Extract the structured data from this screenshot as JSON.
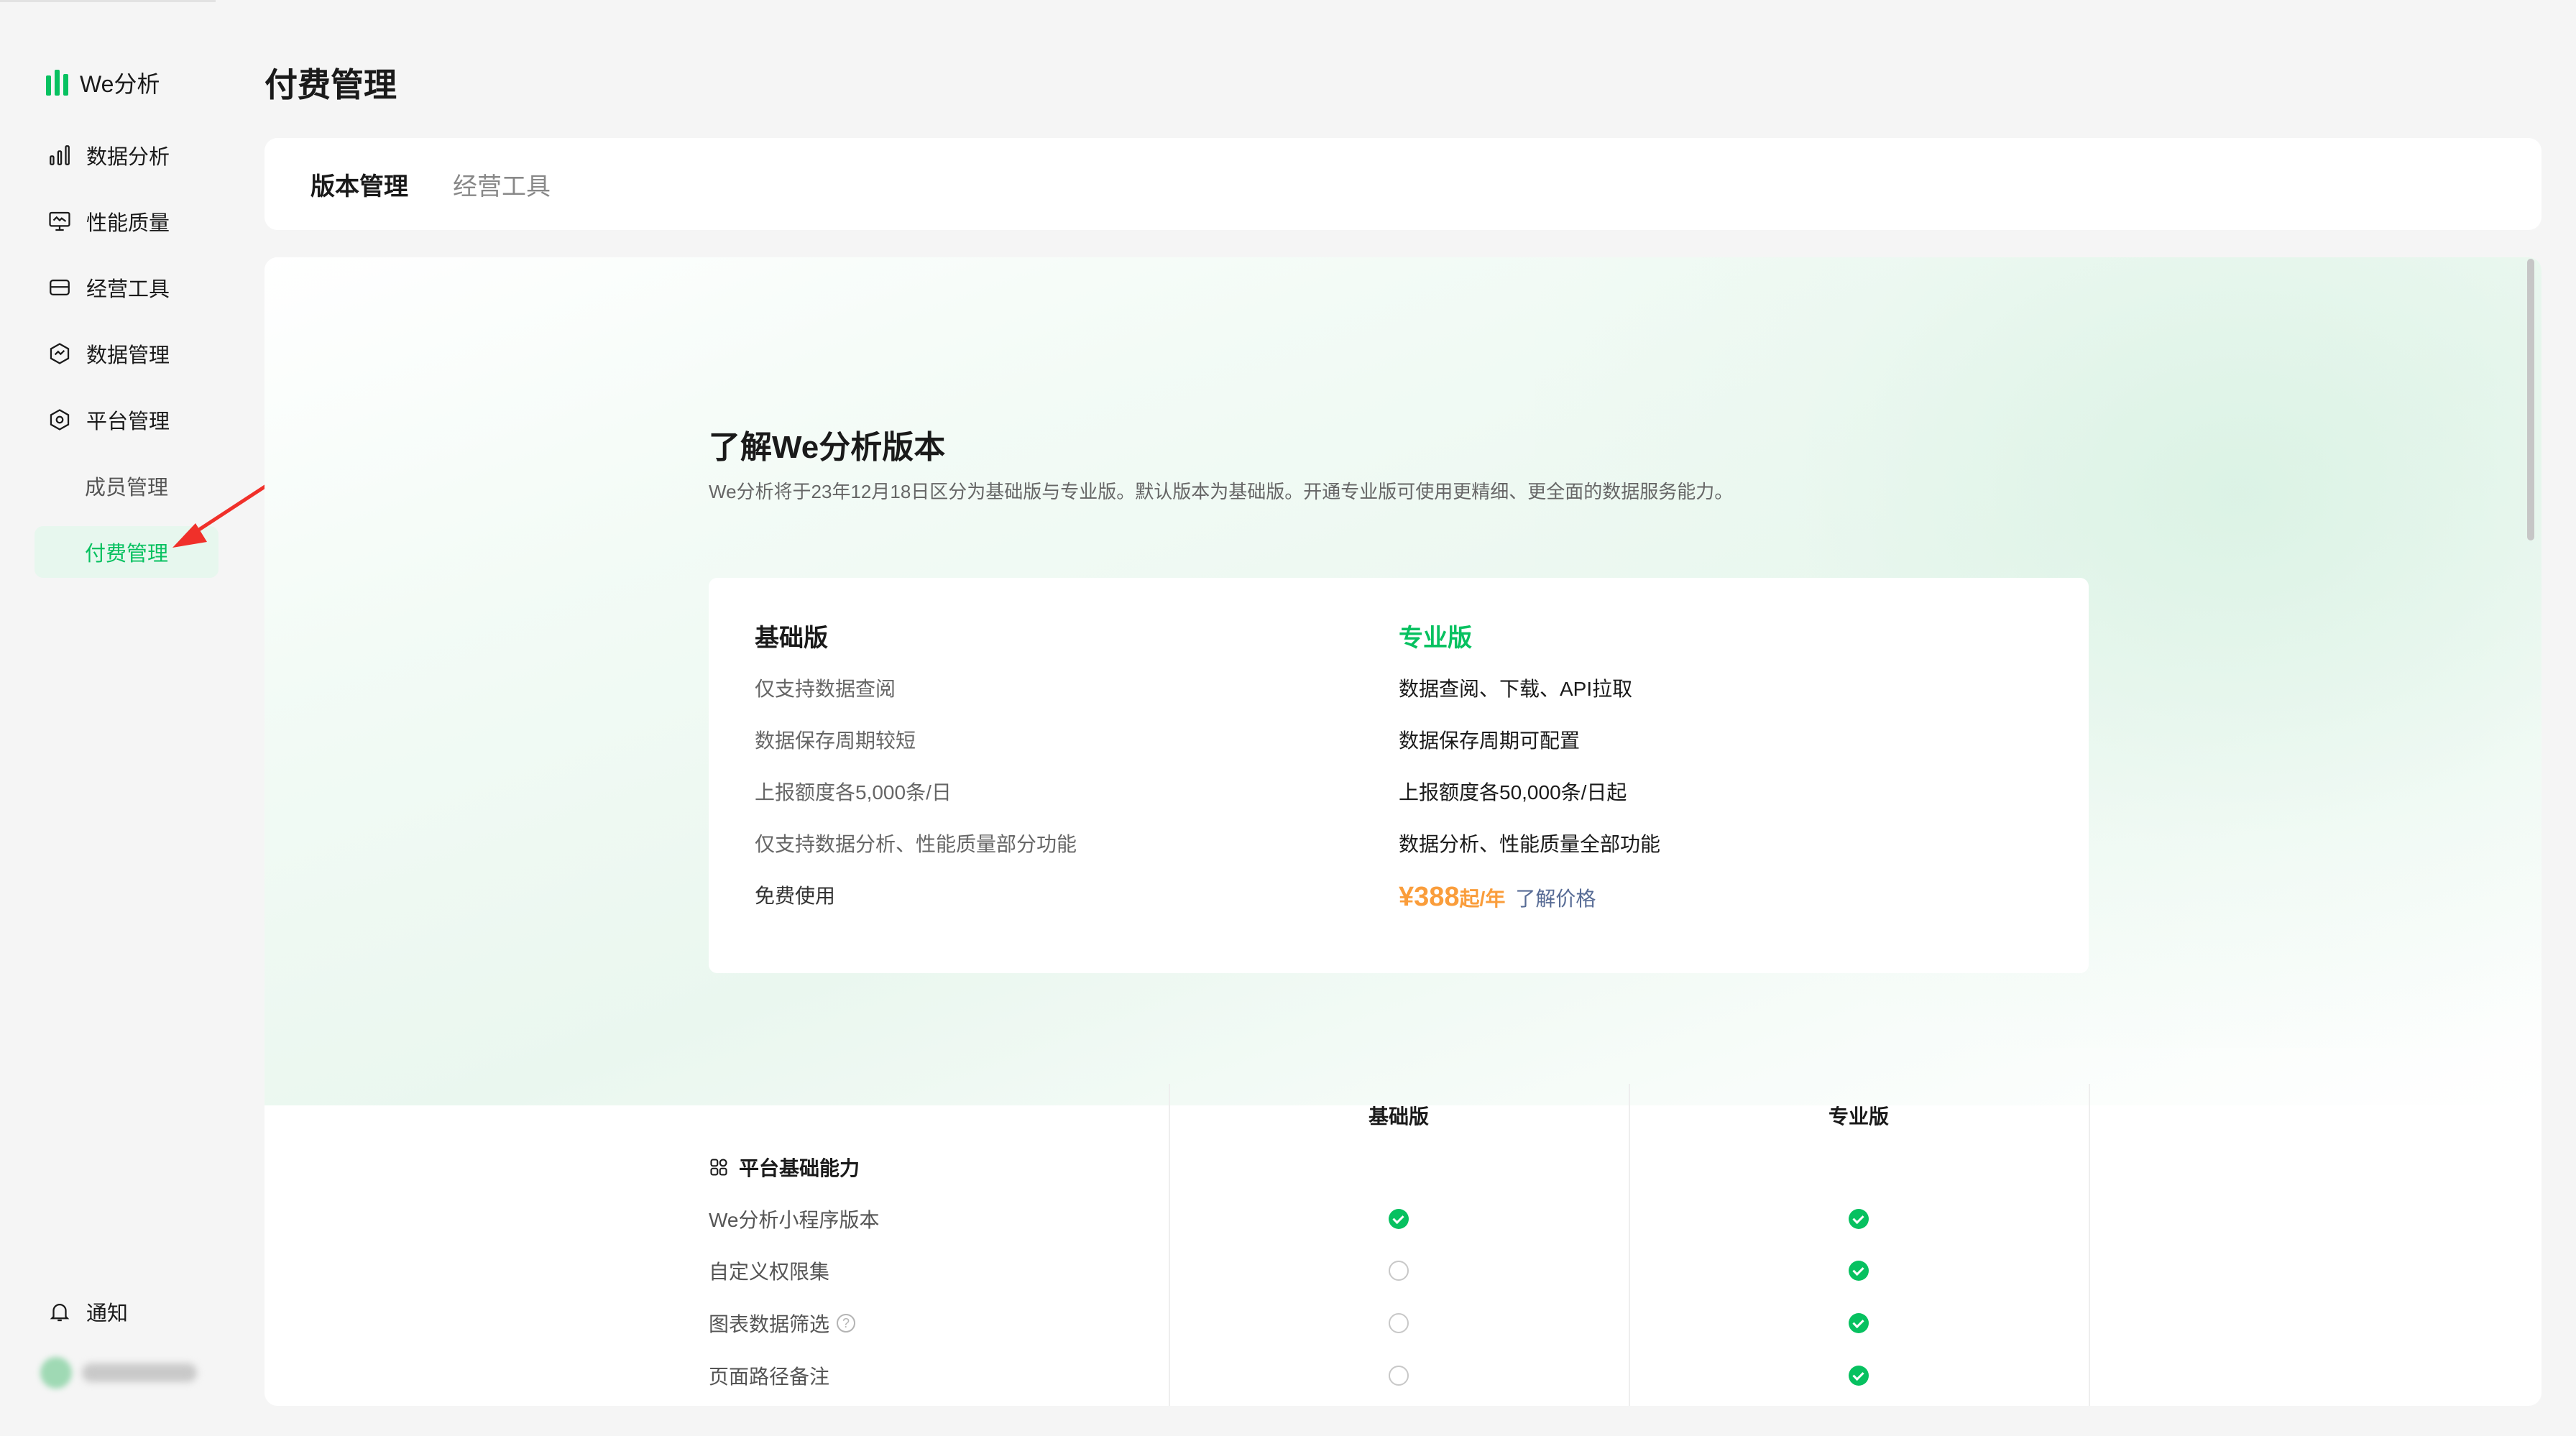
{
  "sidebar": {
    "logo_text": "We分析",
    "items": [
      {
        "label": "数据分析",
        "icon": "bar-chart-icon"
      },
      {
        "label": "性能质量",
        "icon": "monitor-icon"
      },
      {
        "label": "经营工具",
        "icon": "card-icon"
      },
      {
        "label": "数据管理",
        "icon": "hexagon-chart-icon"
      },
      {
        "label": "平台管理",
        "icon": "hexagon-settings-icon"
      }
    ],
    "sub_items": [
      {
        "label": "成员管理",
        "active": false
      },
      {
        "label": "付费管理",
        "active": true
      }
    ],
    "notify_label": "通知",
    "accent_color": "#07c160"
  },
  "page": {
    "title": "付费管理",
    "tabs": [
      {
        "label": "版本管理",
        "active": true
      },
      {
        "label": "经营工具",
        "active": false
      }
    ]
  },
  "intro": {
    "title": "了解We分析版本",
    "description": "We分析将于23年12月18日区分为基础版与专业版。默认版本为基础版。开通专业版可使用更精细、更全面的数据服务能力。"
  },
  "plans": {
    "basic": {
      "name": "基础版",
      "features": [
        "仅支持数据查阅",
        "数据保存周期较短",
        "上报额度各5,000条/日",
        "仅支持数据分析、性能质量部分功能"
      ],
      "price_text": "免费使用"
    },
    "pro": {
      "name": "专业版",
      "features": [
        "数据查阅、下载、API拉取",
        "数据保存周期可配置",
        "上报额度各50,000条/日起",
        "数据分析、性能质量全部功能"
      ],
      "price": "¥388",
      "price_unit": "起/年",
      "price_link": "了解价格",
      "price_color": "#fa9d3b",
      "link_color": "#576b95"
    }
  },
  "table": {
    "headers": [
      "基础版",
      "专业版"
    ],
    "section": "平台基础能力",
    "rows": [
      {
        "label": "We分析小程序版本",
        "basic": true,
        "pro": true,
        "help": false
      },
      {
        "label": "自定义权限集",
        "basic": false,
        "pro": true,
        "help": false
      },
      {
        "label": "图表数据筛选",
        "basic": false,
        "pro": true,
        "help": true
      },
      {
        "label": "页面路径备注",
        "basic": false,
        "pro": true,
        "help": false
      }
    ]
  }
}
